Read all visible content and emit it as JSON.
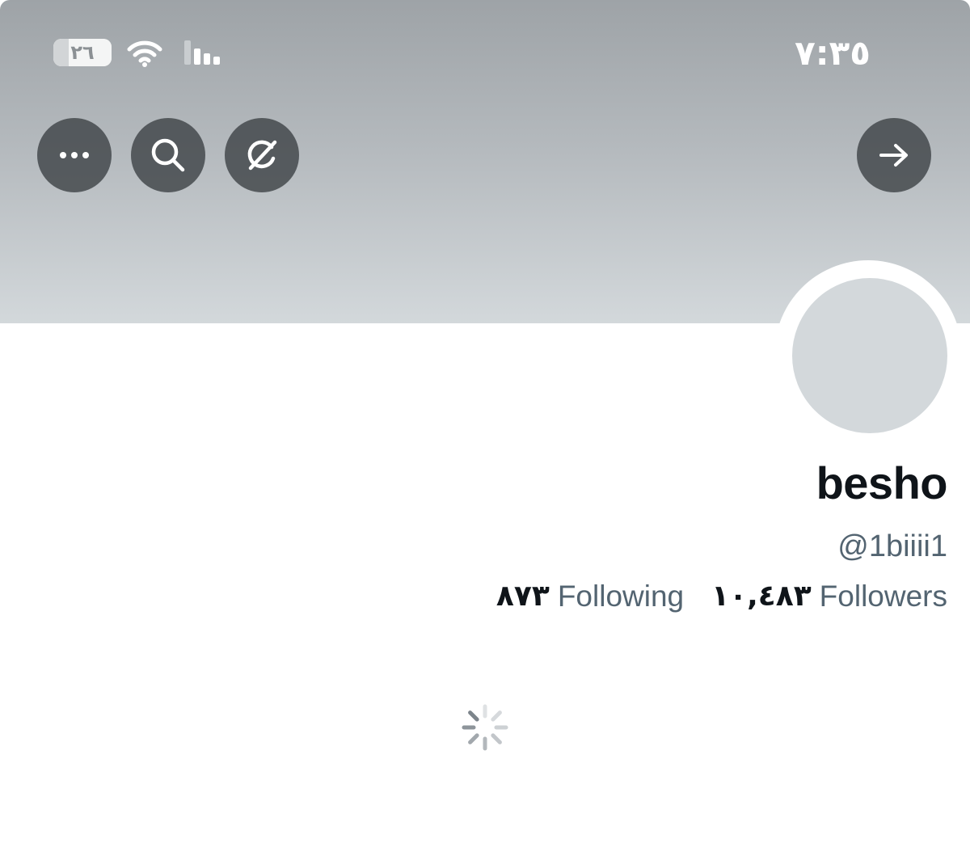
{
  "status_bar": {
    "battery_level": "٢٦",
    "battery_fraction": 0.26,
    "time": "٧:٣٥",
    "wifi_icon": "wifi-icon",
    "signal_icon": "cellular-signal-icon"
  },
  "header_buttons": {
    "more_icon": "ellipsis-icon",
    "search_icon": "search-icon",
    "grok_icon": "grok-icon",
    "forward_icon": "arrow-right-icon"
  },
  "profile": {
    "display_name": "besho",
    "handle": "@1biiii1",
    "followers": {
      "count": "١٠,٤٨٣",
      "label": "Followers"
    },
    "following": {
      "count": "٨٧٣",
      "label": "Following"
    }
  },
  "colors": {
    "banner_top": "#9ea3a7",
    "banner_bottom": "#d3d8db",
    "button_bg": "#404448",
    "text_primary": "#0f1419",
    "text_secondary": "#536471",
    "avatar_placeholder": "#d3d8db"
  },
  "loading_icon": "loading-spinner-icon"
}
